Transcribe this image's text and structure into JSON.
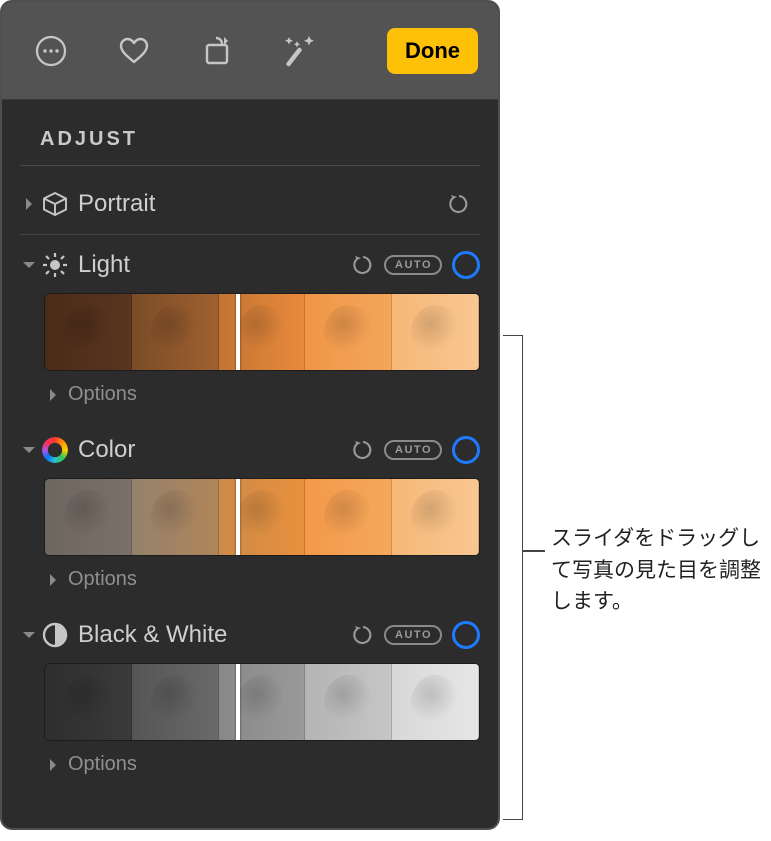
{
  "toolbar": {
    "done_label": "Done"
  },
  "section_title": "ADJUST",
  "adjustments": {
    "portrait": {
      "label": "Portrait"
    },
    "light": {
      "label": "Light",
      "auto_label": "AUTO",
      "options_label": "Options"
    },
    "color": {
      "label": "Color",
      "auto_label": "AUTO",
      "options_label": "Options"
    },
    "bw": {
      "label": "Black & White",
      "auto_label": "AUTO",
      "options_label": "Options"
    }
  },
  "callout": {
    "text": "スライダをドラッグして写真の見た目を調整します。"
  }
}
